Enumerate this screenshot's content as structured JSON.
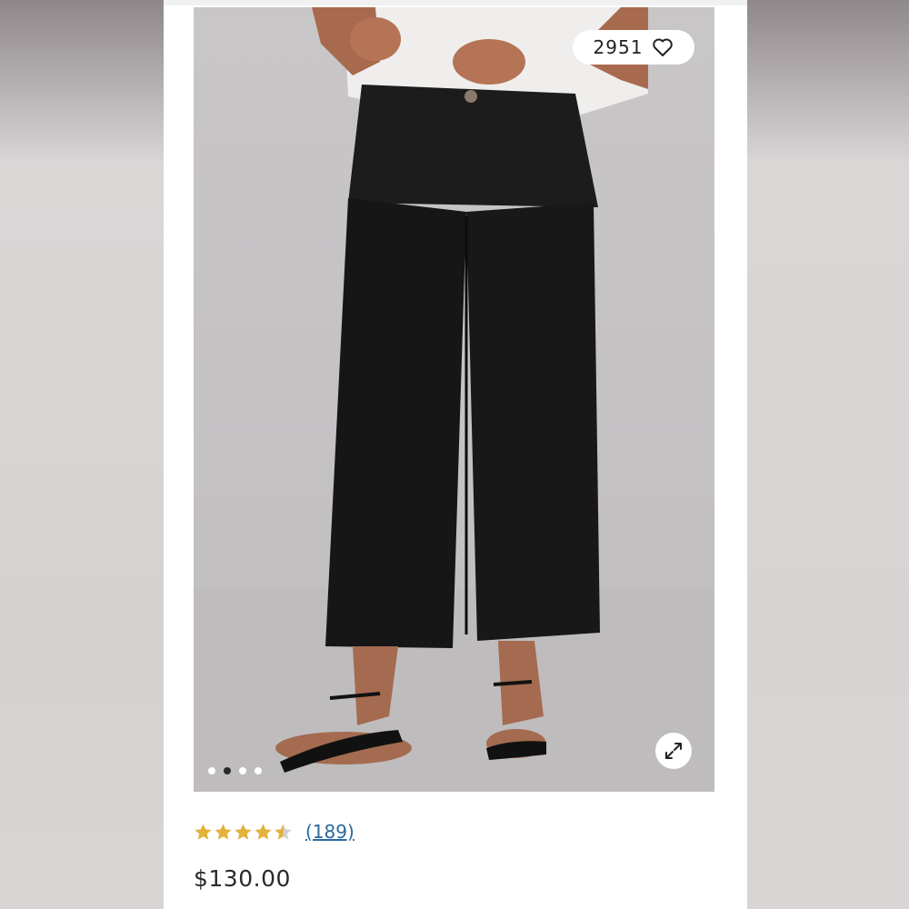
{
  "product": {
    "favorite_count": "2951",
    "rating_value": 4.5,
    "reviews_count": "(189)",
    "price": "$130.00"
  },
  "gallery": {
    "total_images": 4,
    "active_index": 1
  },
  "icons": {
    "favorite": "heart-outline-icon",
    "expand": "expand-arrows-icon",
    "rating": "star-icon"
  },
  "colors": {
    "accent_link": "#2b6a9e",
    "star": "#e3b23c",
    "price_text": "#2a2a2a"
  }
}
